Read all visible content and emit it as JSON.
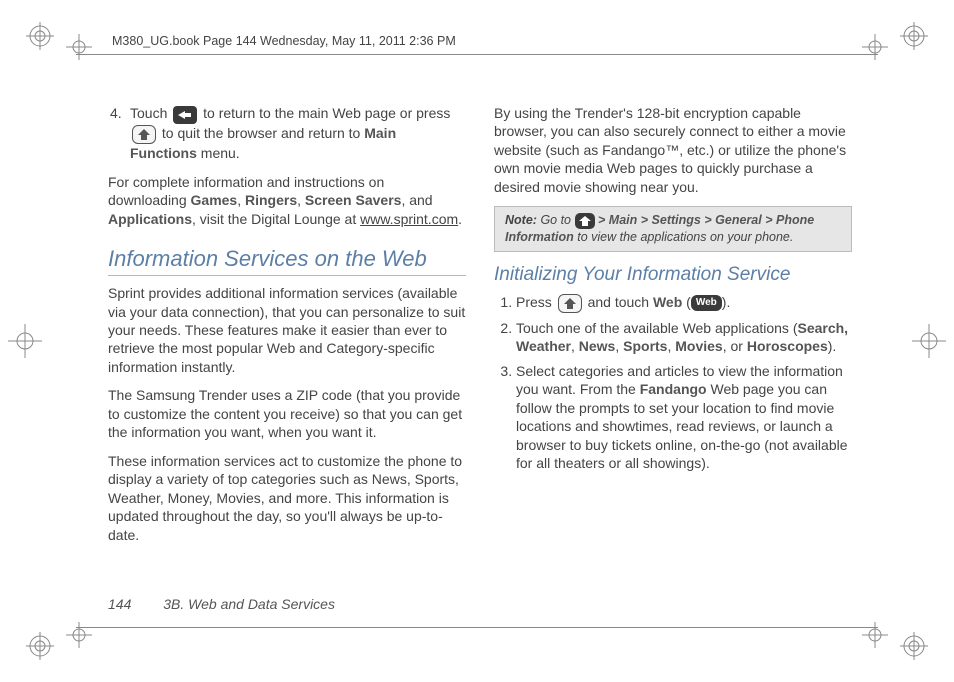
{
  "header": {
    "running_head": "M380_UG.book  Page 144  Wednesday, May 11, 2011  2:36 PM"
  },
  "left_column": {
    "step4_a": "Touch",
    "step4_b": "to return to the main Web page or press",
    "step4_c": "to quit the browser and return to",
    "step4_bold1": "Main Functions",
    "step4_d": "menu.",
    "p1_a": "For complete information and instructions on downloading",
    "p1_bold": "Games",
    "p1_sep": ",",
    "p1_bold2": "Ringers",
    "p1_bold3": "Screen Savers",
    "p1_and": ", and",
    "p1_bold4": "Applications",
    "p1_b": ", visit the Digital Lounge at",
    "p1_link": "www.sprint.com",
    "h1": "Information Services on the Web",
    "p2": "Sprint provides additional information services (available via your data connection), that you can personalize to suit your needs. These features make it easier than ever to retrieve the most popular Web and Category-specific information instantly.",
    "p3": "The Samsung Trender uses a ZIP code (that you provide to customize the content you receive) so that you can get the information you want, when you want it.",
    "p4": "These information services act to customize the phone to display a variety of top categories such as News, Sports, Weather, Money, Movies, and more. This information is updated throughout the day, so you'll always be up-to-date."
  },
  "right_column": {
    "p1": "By using the Trender's 128-bit encryption capable browser, you can also securely connect to either a movie website (such as Fandango™, etc.) or utilize the phone's own movie media Web pages to quickly purchase a desired movie showing near you.",
    "note_label": "Note:",
    "note_a": "Go to",
    "note_gt": ">",
    "note_b1": "Main",
    "note_b2": "Settings",
    "note_b3": "General",
    "note_b4": "Phone Information",
    "note_c": "to view the applications on your phone.",
    "h2": "Initializing Your Information Service",
    "s1_a": "Press",
    "s1_b": "and touch",
    "s1_bold": "Web",
    "s1_c": "(",
    "s1_web": "Web",
    "s1_d": ").",
    "s2_a": "Touch one of the available Web applications (",
    "s2_b1": "Search, Weather",
    "s2_b2": "News",
    "s2_b3": "Sports",
    "s2_b4": "Movies",
    "s2_or": ", or",
    "s2_b5": "Horoscopes",
    "s2_c": ").",
    "s3_a": "Select categories and articles to view the information you want. From the",
    "s3_bold": "Fandango",
    "s3_b": "Web page you can follow the prompts to set your location to find movie locations and showtimes, read reviews, or launch a browser to buy tickets online, on-the-go (not available for all theaters or all showings)."
  },
  "footer": {
    "page_num": "144",
    "section": "3B. Web and Data Services"
  }
}
